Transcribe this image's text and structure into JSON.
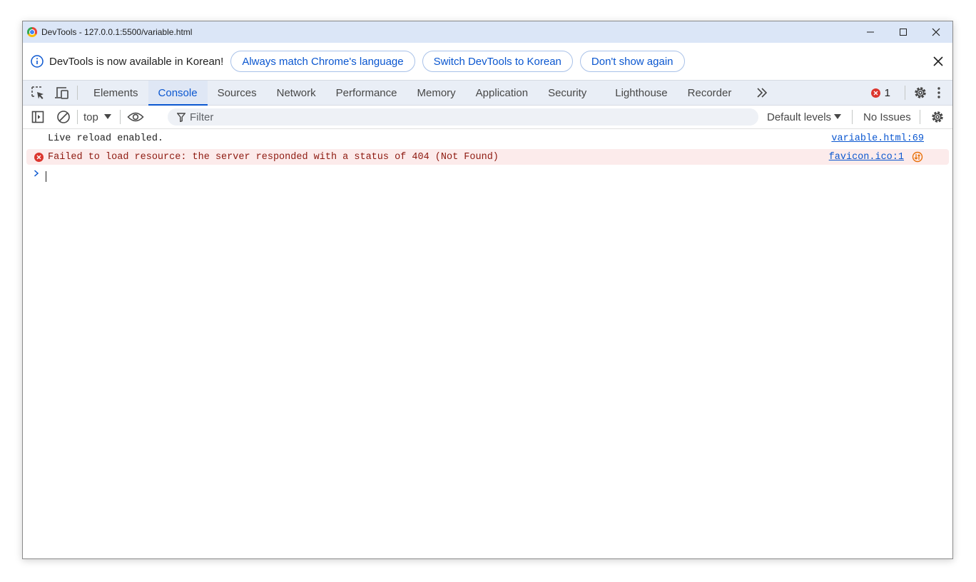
{
  "window": {
    "title": "DevTools - 127.0.0.1:5500/variable.html",
    "controls": [
      "minimize-icon",
      "maximize-icon",
      "close-icon"
    ]
  },
  "infobar": {
    "message": "DevTools is now available in Korean!",
    "buttons": [
      "Always match Chrome's language",
      "Switch DevTools to Korean",
      "Don't show again"
    ]
  },
  "tabs": {
    "items": [
      "Elements",
      "Console",
      "Sources",
      "Network",
      "Performance",
      "Memory",
      "Application",
      "Security",
      "Lighthouse",
      "Recorder"
    ],
    "active": "Console",
    "error_count": "1"
  },
  "console_toolbar": {
    "context": "top",
    "filter_placeholder": "Filter",
    "levels": "Default levels",
    "issues": "No Issues"
  },
  "messages": [
    {
      "level": "info",
      "text": "Live reload enabled.",
      "source": "variable.html:69"
    },
    {
      "level": "error",
      "text": "Failed to load resource: the server responded with a status of 404 (Not Found)",
      "source": "favicon.ico:1"
    }
  ],
  "colors": {
    "accent": "#0b57d0",
    "error": "#dc362e",
    "error_bg": "#fcebeb",
    "titlebar": "#dbe6f7",
    "tabbar": "#e9eef6"
  }
}
